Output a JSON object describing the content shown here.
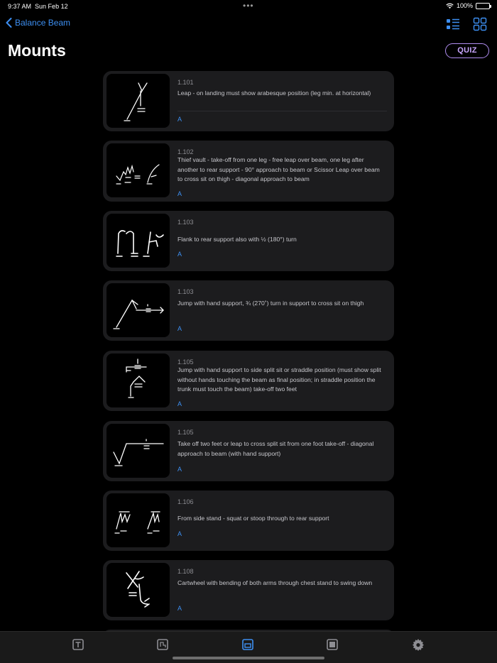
{
  "status": {
    "time": "9:37 AM",
    "date": "Sun Feb 12",
    "battery": "100%"
  },
  "nav": {
    "back_label": "Balance Beam",
    "list_view_icon": "list-icon",
    "grid_view_icon": "grid-icon"
  },
  "header": {
    "title": "Mounts",
    "quiz_label": "QUIZ"
  },
  "items": [
    {
      "code": "1.101",
      "description": "Leap - on landing must show arabesque position (leg min. at horizontal)",
      "grade": "A"
    },
    {
      "code": "1.102",
      "description": "Thief vault - take-off from one leg - free leap over beam, one leg after another to rear support - 90° approach to beam or Scissor Leap over beam to cross sit on thigh - diagonal approach to beam",
      "grade": "A"
    },
    {
      "code": "1.103",
      "description": "Flank to rear support also with ½ (180°) turn",
      "grade": "A"
    },
    {
      "code": "1.103",
      "description": "Jump with hand support, ¾ (270˚) turn in support to cross sit on thigh",
      "grade": "A"
    },
    {
      "code": "1.105",
      "description": "Jump with hand support to side split sit or straddle position (must show split without hands touching the beam as final position; in straddle position the trunk must touch the beam) take-off two feet",
      "grade": "A"
    },
    {
      "code": "1.105",
      "description": "Take off two feet or leap to cross split sit from one foot take-off - diagonal approach to beam (with hand support)",
      "grade": "A"
    },
    {
      "code": "1.106",
      "description": "From side stand - squat or stoop through to rear support",
      "grade": "A"
    },
    {
      "code": "1.108",
      "description": "Cartwheel with bending of both arms through chest stand to swing down",
      "grade": "A"
    }
  ],
  "tabs": [
    {
      "name": "text-tab",
      "active": false
    },
    {
      "name": "symbols-tab",
      "active": false
    },
    {
      "name": "beam-tab",
      "active": true
    },
    {
      "name": "card-tab",
      "active": false
    },
    {
      "name": "settings-tab",
      "active": false
    }
  ],
  "colors": {
    "accent": "#3d8ff2",
    "quiz": "#c9a6ff",
    "card": "#1c1c1e",
    "background": "#000000"
  }
}
